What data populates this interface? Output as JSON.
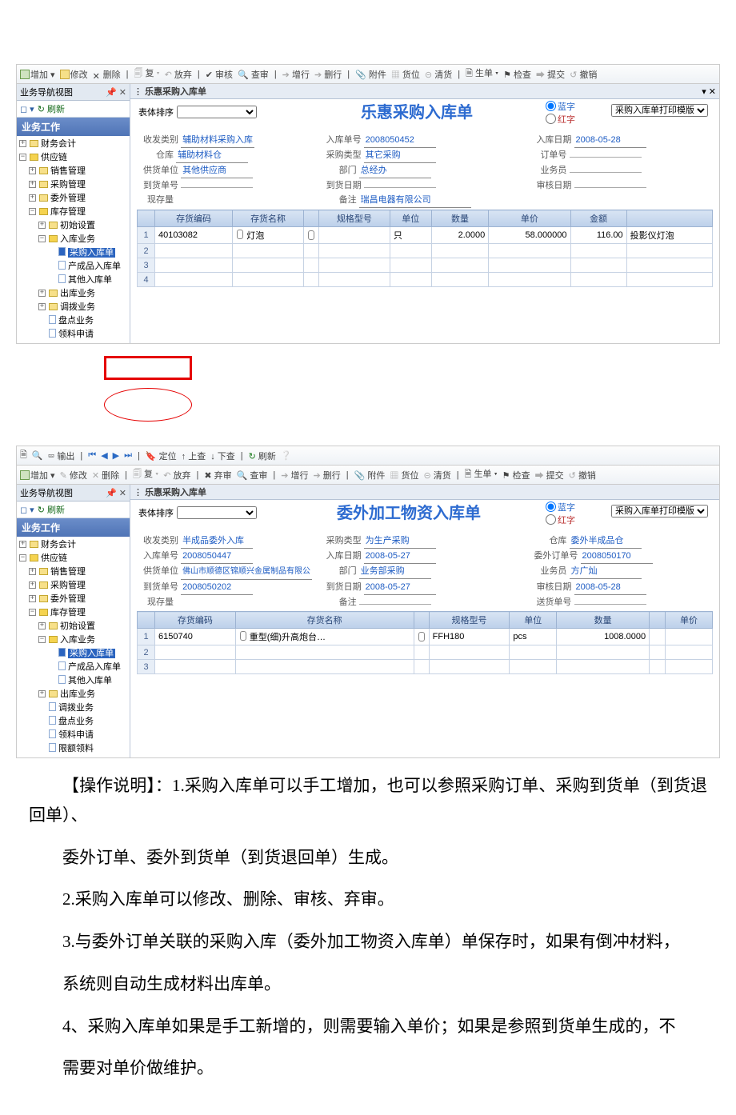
{
  "toolbar": {
    "add": "增加",
    "edit": "修改",
    "del": "删除",
    "copy": "复",
    "drop": "放弃",
    "audit": "审核",
    "qry": "查审",
    "addrow": "增行",
    "delrow": "删行",
    "attach": "附件",
    "loc": "货位",
    "clear": "清货",
    "make": "生单",
    "chk": "检查",
    "submit": "提交",
    "undo": "撤销",
    "export": "输出",
    "locate": "定位",
    "up": "上查",
    "down": "下查",
    "refresh": "刷新",
    "abandon": "弃审"
  },
  "nav": {
    "title": "业务导航视图",
    "refresh": "刷新",
    "header": "业务工作",
    "items": {
      "fa": "财务会计",
      "sc": "供应链",
      "sale": "销售管理",
      "buy": "采购管理",
      "out": "委外管理",
      "stk": "库存管理",
      "init": "初始设置",
      "in": "入库业务",
      "cg": "采购入库单",
      "cp": "产成品入库单",
      "qt": "其他入库单",
      "outb": "出库业务",
      "adj": "调拨业务",
      "pd": "盘点业务",
      "lq": "领料申请",
      "lq2": "限额领料"
    }
  },
  "shot1": {
    "tab": "乐惠采购入库单",
    "title": "乐惠采购入库单",
    "tmpl": "采购入库单打印模版",
    "sortlbl": "表体排序",
    "radio1": "蓝字",
    "radio2": "红字",
    "f": {
      "sflb_l": "收发类别",
      "sflb_v": "辅助材料采购入库",
      "rkdh_l": "入库单号",
      "rkdh_v": "2008050452",
      "rkrq_l": "入库日期",
      "rkrq_v": "2008-05-28",
      "ck_l": "仓库",
      "ck_v": "辅助材料仓",
      "cglx_l": "采购类型",
      "cglx_v": "其它采购",
      "ddh_l": "订单号",
      "gh_l": "供货单位",
      "gh_v": "其他供应商",
      "bm_l": "部门",
      "bm_v": "总经办",
      "ywy_l": "业务员",
      "dhd_l": "到货单号",
      "dhrq_l": "到货日期",
      "shrq_l": "审核日期",
      "xcl_l": "现存量",
      "bz_l": "备注",
      "bz_v": "瑞昌电器有限公司"
    },
    "cols": [
      "存货编码",
      "存货名称",
      "",
      "规格型号",
      "单位",
      "数量",
      "单价",
      "金额",
      ""
    ],
    "row": [
      "40103082",
      "灯泡",
      "",
      "",
      "只",
      "2.0000",
      "58.000000",
      "116.00",
      "投影仪灯泡"
    ]
  },
  "shot2": {
    "tab": "乐惠采购入库单",
    "title": "委外加工物资入库单",
    "tmpl": "采购入库单打印模版",
    "sortlbl": "表体排序",
    "radio1": "蓝字",
    "radio2": "红字",
    "f": {
      "sflb_l": "收发类别",
      "sflb_v": "半成品委外入库",
      "cglx_l": "采购类型",
      "cglx_v": "为生产采购",
      "ck_l": "仓库",
      "ck_v": "委外半成品仓",
      "rkdh_l": "入库单号",
      "rkdh_v": "2008050447",
      "rkrq_l": "入库日期",
      "rkrq_v": "2008-05-27",
      "wwdh_l": "委外订单号",
      "wwdh_v": "2008050170",
      "gh_l": "供货单位",
      "gh_v": "佛山市顺德区锦顺兴金属制品有限公",
      "bm_l": "部门",
      "bm_v": "业务部采购",
      "ywy_l": "业务员",
      "ywy_v": "方广灿",
      "dhd_l": "到货单号",
      "dhd_v": "2008050202",
      "dhrq_l": "到货日期",
      "dhrq_v": "2008-05-27",
      "shrq_l": "审核日期",
      "shrq_v": "2008-05-28",
      "xcl_l": "现存量",
      "bz_l": "备注",
      "shd_l": "送货单号"
    },
    "cols": [
      "存货编码",
      "存货名称",
      "",
      "规格型号",
      "单位",
      "数量",
      "",
      "单价"
    ],
    "row": [
      "6150740",
      "重型(细)升高炮台…",
      "FFH180",
      "pcs",
      "1008.0000",
      "",
      "",
      ""
    ]
  },
  "paras": [
    "【操作说明】：1.采购入库单可以手工增加，也可以参照采购订单、采购到货单（到货退回单）、",
    "委外订单、委外到货单（到货退回单）生成。",
    "2.采购入库单可以修改、删除、审核、弃审。",
    "3.与委外订单关联的采购入库（委外加工物资入库单）单保存时，如果有倒冲材料，",
    "系统则自动生成材料出库单。",
    "4、采购入库单如果是手工新增的，则需要输入单价；如果是参照到货单生成的，不",
    "需要对单价做维护。"
  ]
}
